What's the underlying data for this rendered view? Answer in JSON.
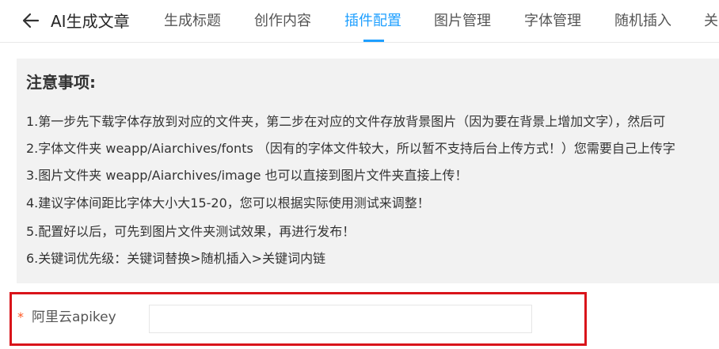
{
  "header": {
    "back_icon": "arrow-left-icon",
    "title": "AI生成文章",
    "tabs": [
      {
        "label": "生成标题",
        "active": false
      },
      {
        "label": "创作内容",
        "active": false
      },
      {
        "label": "插件配置",
        "active": true
      },
      {
        "label": "图片管理",
        "active": false
      },
      {
        "label": "字体管理",
        "active": false
      },
      {
        "label": "随机插入",
        "active": false
      },
      {
        "label": "关",
        "active": false
      }
    ],
    "accent_color": "#1e9fff"
  },
  "notice": {
    "title": "注意事项:",
    "lines": [
      "1.第一步先下载字体存放到对应的文件夹，第二步在对应的文件存放背景图片（因为要在背景上增加文字），然后可",
      "2.字体文件夹 weapp/Aiarchives/fonts （因有的字体文件较大，所以暂不支持后台上传方式！）您需要自己上传字",
      "3.图片文件夹 weapp/Aiarchives/image 也可以直接到图片文件夹直接上传！",
      "4.建议字体间距比字体大小大15-20，您可以根据实际使用测试来调整！",
      "5.配置好以后，可先到图片文件夹测试效果，再进行发布！",
      "6.关键词优先级：关键词替换>随机插入>关键词内链"
    ]
  },
  "form": {
    "required_mark": "*",
    "apikey_label": "阿里云apikey",
    "apikey_value": "",
    "highlight_color": "#d9141a"
  }
}
